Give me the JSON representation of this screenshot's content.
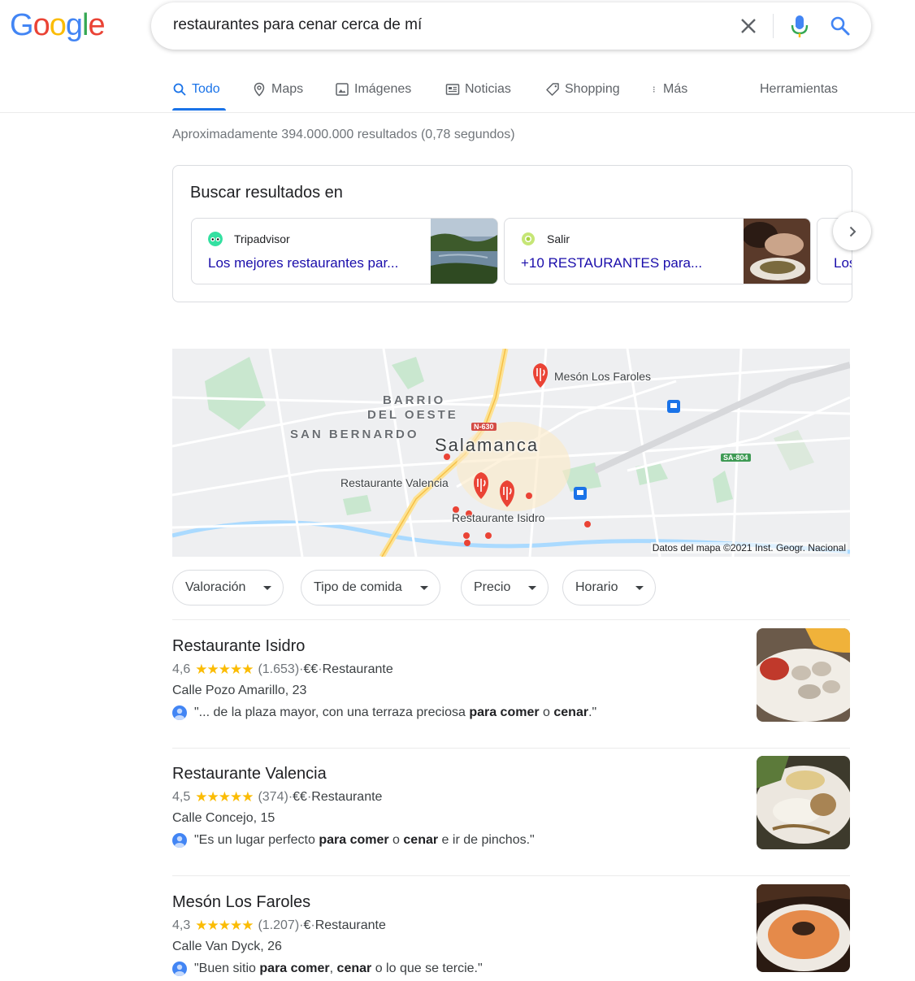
{
  "logo": {
    "letters": [
      "G",
      "o",
      "o",
      "g",
      "l",
      "e"
    ],
    "colors": [
      "#4285f4",
      "#ea4335",
      "#fbbc05",
      "#4285f4",
      "#34a853",
      "#ea4335"
    ]
  },
  "search": {
    "query": "restaurantes para cenar cerca de mí"
  },
  "tabs": [
    {
      "label": "Todo",
      "icon": "search-icon"
    },
    {
      "label": "Maps",
      "icon": "map-pin-icon"
    },
    {
      "label": "Imágenes",
      "icon": "image-icon"
    },
    {
      "label": "Noticias",
      "icon": "newspaper-icon"
    },
    {
      "label": "Shopping",
      "icon": "tag-icon"
    },
    {
      "label": "Más",
      "icon": "more-vert-icon"
    }
  ],
  "tools_label": "Herramientas",
  "stats": "Aproximadamente 394.000.000 resultados (0,78 segundos)",
  "sources": {
    "title": "Buscar resultados en",
    "cards": [
      {
        "source": "Tripadvisor",
        "link": "Los mejores restaurantes par...",
        "dot_color": "#34e0a1"
      },
      {
        "source": "Salir",
        "link": "+10 RESTAURANTES para...",
        "dot_color": "#a8d33f"
      },
      {
        "source": "",
        "link": "Los"
      }
    ]
  },
  "map": {
    "places": [
      "Mesón Los Faroles",
      "Restaurante Valencia",
      "Restaurante Isidro"
    ],
    "districts": [
      "BARRIO",
      "DEL OESTE",
      "SAN BERNARDO"
    ],
    "city": "Salamanca",
    "roads": [
      "N-630",
      "SA-804"
    ],
    "copyright": "Datos del mapa ©2021 Inst. Geogr. Nacional"
  },
  "filters": [
    "Valoración",
    "Tipo de comida",
    "Precio",
    "Horario"
  ],
  "results": [
    {
      "name": "Restaurante Isidro",
      "rating": "4,6",
      "stars": "★★★★★",
      "count": "(1.653)",
      "price": "€€",
      "category": "Restaurante",
      "address": "Calle Pozo Amarillo, 23",
      "review": {
        "pre": "\"... de la plaza mayor, con una terraza preciosa ",
        "b1": "para comer",
        "mid": " o ",
        "b2": "cenar",
        "post": ".\""
      }
    },
    {
      "name": "Restaurante Valencia",
      "rating": "4,5",
      "stars": "★★★★★",
      "count": "(374)",
      "price": "€€",
      "category": "Restaurante",
      "address": "Calle Concejo, 15",
      "review": {
        "pre": "\"Es un lugar perfecto ",
        "b1": "para comer",
        "mid": " o ",
        "b2": "cenar",
        "post": " e ir de pinchos.\""
      }
    },
    {
      "name": "Mesón Los Faroles",
      "rating": "4,3",
      "stars": "★★★★★",
      "count": "(1.207)",
      "price": "€",
      "category": "Restaurante",
      "address": "Calle Van Dyck, 26",
      "review": {
        "pre": "\"Buen sitio ",
        "b1": "para comer",
        "mid": ", ",
        "b2": "cenar",
        "post": " o lo que se tercie.\""
      }
    }
  ],
  "meta_sep": " · ",
  "colors": {
    "link": "#1a0dab",
    "accent": "#1a73e8",
    "star": "#fbbc04",
    "pin": "#ea4335"
  }
}
